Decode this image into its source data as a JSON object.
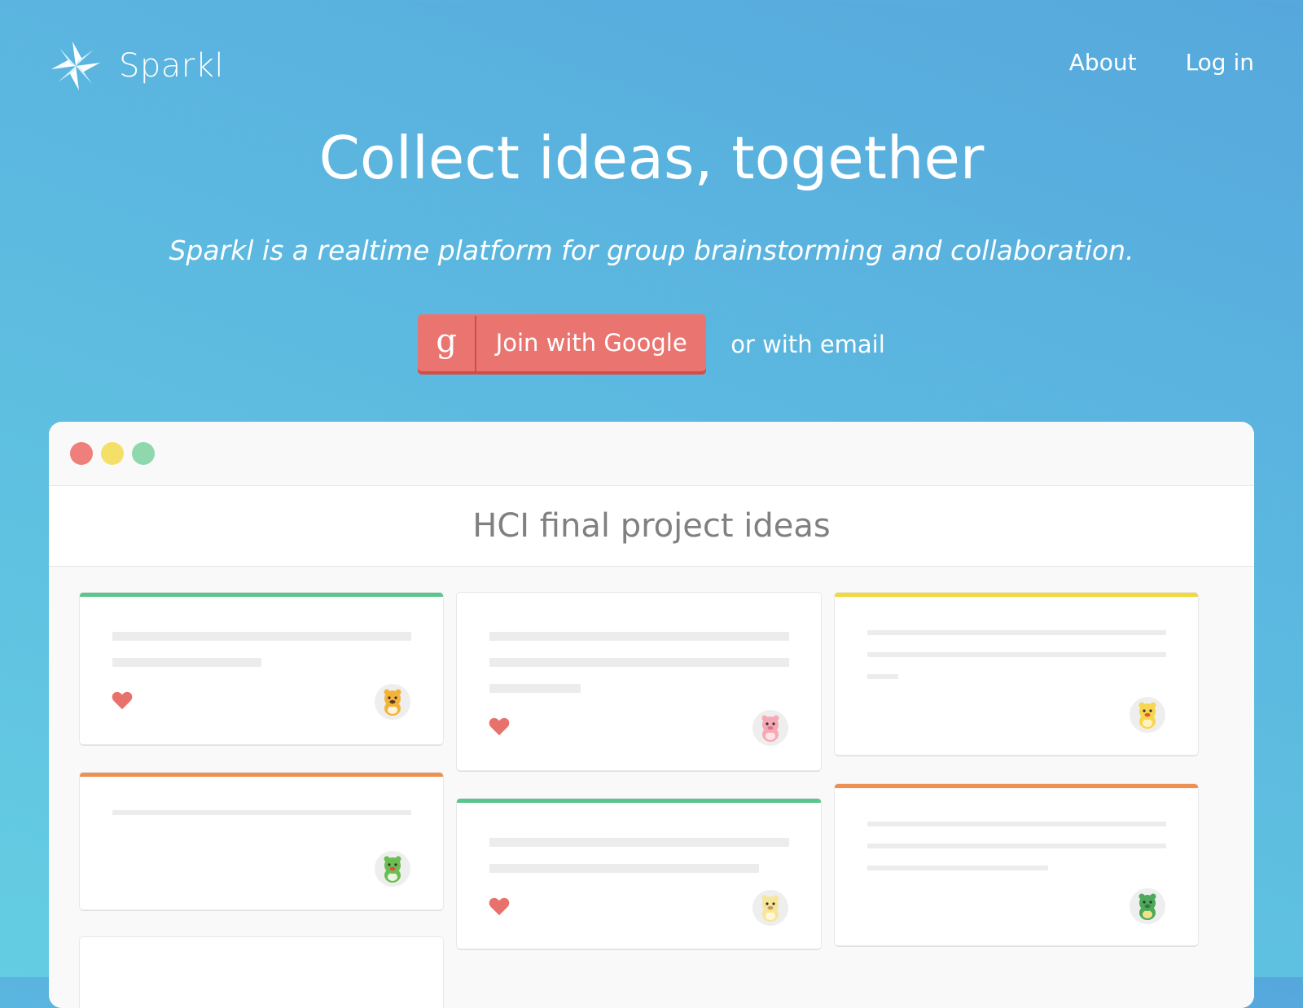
{
  "brand": {
    "name": "Sparkl",
    "logo_icon": "sparkle-star-icon"
  },
  "nav": {
    "about": "About",
    "login": "Log in"
  },
  "hero": {
    "title": "Collect ideas, together",
    "tagline": "Sparkl is a realtime platform for group brainstorming and collaboration."
  },
  "cta": {
    "google_icon_glyph": "g",
    "google_label": "Join with Google",
    "email_label": "or with email"
  },
  "window": {
    "dot_colors": [
      "#ee7f7b",
      "#f4e068",
      "#8fd8ae"
    ],
    "board_title": "HCI final project ideas"
  },
  "colors": {
    "google_button": "#ea7570",
    "heart": "#e8716c",
    "stripe_green": "#59c68b",
    "stripe_yellow": "#f0d93c",
    "stripe_orange": "#ec9053"
  },
  "cards": [
    {
      "stripe": "green",
      "liked": true,
      "avatar": "tiger-avatar-icon"
    },
    {
      "stripe": "none",
      "liked": true,
      "avatar": "pig-avatar-icon"
    },
    {
      "stripe": "yellow",
      "liked": false,
      "avatar": "chick-avatar-icon"
    },
    {
      "stripe": "orange",
      "liked": false,
      "avatar": "dragon-avatar-icon"
    },
    {
      "stripe": "green",
      "liked": true,
      "avatar": "sheep-avatar-icon"
    },
    {
      "stripe": "orange",
      "liked": false,
      "avatar": "snake-avatar-icon"
    }
  ]
}
